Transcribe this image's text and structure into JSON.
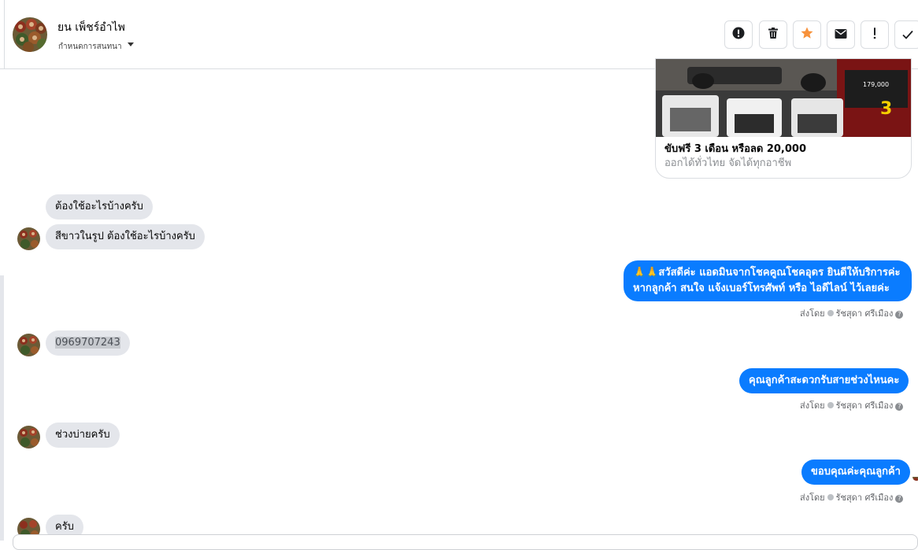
{
  "header": {
    "contact_name": "ยน เพ็ชร์อำไพ",
    "assign_label": "กำหนดการสนทนา",
    "toolbar": [
      {
        "icon": "alert-circle-icon",
        "name": "mark-spam-button"
      },
      {
        "icon": "trash-icon",
        "name": "delete-button"
      },
      {
        "icon": "star-icon",
        "name": "star-button"
      },
      {
        "icon": "envelope-icon",
        "name": "mark-unread-button"
      },
      {
        "icon": "exclamation-icon",
        "name": "follow-up-button"
      },
      {
        "icon": "check-icon",
        "name": "mark-done-button"
      }
    ]
  },
  "product_card": {
    "image_price": "179,000",
    "image_badge": "3",
    "title": "ขับฟรี 3 เดือน หรือลด 20,000",
    "subtitle": "ออกได้ทั่วไทย จัดได้ทุกอาชีพ"
  },
  "messages": [
    {
      "direction": "in",
      "text": "ต้องใช้อะไรบ้างครับ"
    },
    {
      "direction": "in",
      "text": "สีขาวในรูป  ต้องใช้อะไรบ้างครับ"
    },
    {
      "direction": "out",
      "lines": [
        "🙏🙏สวัสดีค่ะ แอดมินจากโชคคูณโชคอุดร ยินดีให้บริการค่ะ",
        "หากลูกค้า สนใจ แจ้งเบอร์โทรศัพท์ หรือ ไอดีไลน์  ไว้เลยค่ะ"
      ],
      "sent_by_label": "ส่งโดย",
      "sender": "รัชสุดา ศรีเมือง"
    },
    {
      "direction": "in",
      "text": "0969707243"
    },
    {
      "direction": "out",
      "text": "คุณลูกค้าสะดวกรับสายช่วงไหนคะ",
      "sent_by_label": "ส่งโดย",
      "sender": "รัชสุดา ศรีเมือง"
    },
    {
      "direction": "in",
      "text": "ช่วงบ่ายครับ"
    },
    {
      "direction": "out",
      "text": "ขอบคุณค่ะคุณลูกค้า",
      "sent_by_label": "ส่งโดย",
      "sender": "รัชสุดา ศรีเมือง"
    },
    {
      "direction": "in",
      "text": "ครับ"
    }
  ],
  "colors": {
    "outgoing_bubble": "#0a7cff",
    "incoming_bubble": "#e4e6eb",
    "star": "#f7923b"
  }
}
